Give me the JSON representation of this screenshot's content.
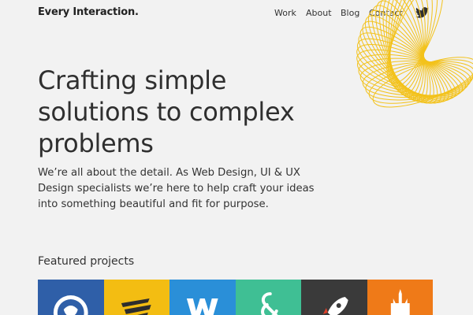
{
  "site": {
    "logo": "Every Interaction."
  },
  "nav": {
    "items": [
      {
        "label": "Work"
      },
      {
        "label": "About"
      },
      {
        "label": "Blog"
      },
      {
        "label": "Contact"
      }
    ],
    "twitter_icon": "twitter-bird-icon"
  },
  "hero": {
    "title": "Crafting simple solutions to complex problems",
    "text": "We’re all about the detail. As Web Design, UI & UX Design specialists we’re here to help craft your ideas into something beautiful and fit for purpose."
  },
  "featured": {
    "heading": "Featured projects",
    "projects": [
      {
        "icon": "lion-crest-icon",
        "color": "#2f5fa8"
      },
      {
        "icon": "fast-lines-icon",
        "color": "#f3bd12"
      },
      {
        "icon": "w-letter-icon",
        "color": "#2a8fd8"
      },
      {
        "icon": "ampersand-icon",
        "color": "#3fbf94"
      },
      {
        "icon": "rocket-icon",
        "color": "#3a3a3a"
      },
      {
        "icon": "castle-icon",
        "color": "#ef7a18"
      }
    ]
  },
  "colors": {
    "background": "#f2f2f2",
    "accent_yellow": "#f3c21b",
    "text": "#2f2f2f"
  }
}
